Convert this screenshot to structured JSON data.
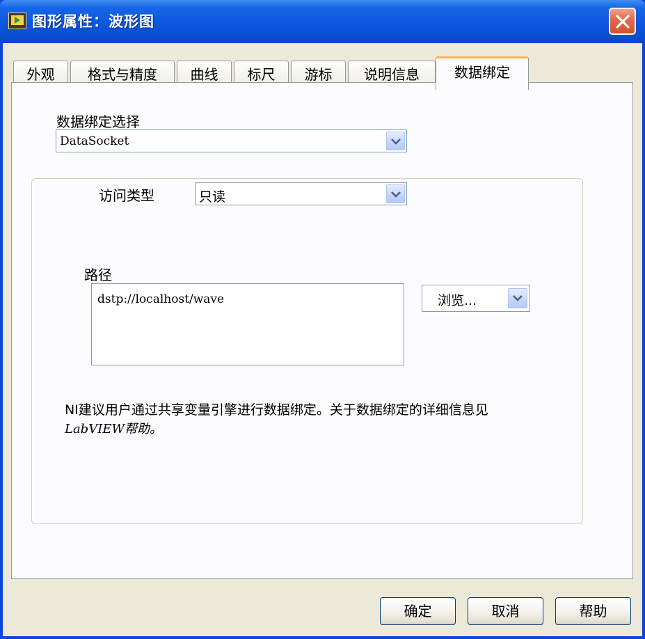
{
  "window": {
    "title": "图形属性：波形图",
    "icon": "labview-vi-icon"
  },
  "tabs": [
    {
      "label": "外观",
      "active": false
    },
    {
      "label": "格式与精度",
      "active": false
    },
    {
      "label": "曲线",
      "active": false
    },
    {
      "label": "标尺",
      "active": false
    },
    {
      "label": "游标",
      "active": false
    },
    {
      "label": "说明信息",
      "active": false
    },
    {
      "label": "数据绑定",
      "active": true
    }
  ],
  "binding": {
    "selection_label": "数据绑定选择",
    "selection_value": "DataSocket",
    "access_label": "访问类型",
    "access_value": "只读",
    "path_label": "路径",
    "path_value": "dstp://localhost/wave",
    "browse_label": "浏览..."
  },
  "note": {
    "line1": "NI建议用户通过共享变量引擎进行数据绑定。关于数据绑定的详细信息见",
    "line2": "LabVIEW帮助。"
  },
  "buttons": {
    "ok": "确定",
    "cancel": "取消",
    "help": "帮助"
  },
  "colors": {
    "titlebar": "#0a4fd4",
    "active_tab_highlight": "#f7b64a",
    "close_button": "#d5502e",
    "dialog_background": "#ece9d8"
  }
}
